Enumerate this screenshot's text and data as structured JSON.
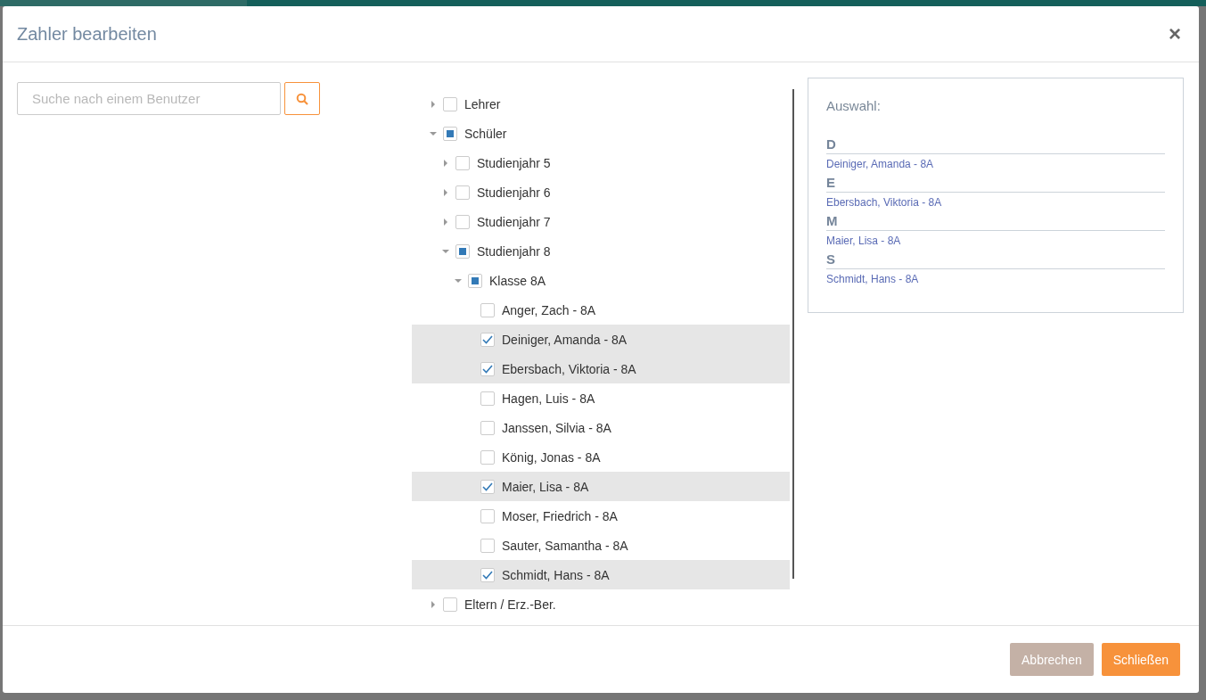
{
  "dialog": {
    "title": "Zahler bearbeiten",
    "close": "×"
  },
  "search": {
    "placeholder": "Suche nach einem Benutzer"
  },
  "tree": [
    {
      "label": "Lehrer",
      "checked": false,
      "indeterminate": false,
      "expanded": false
    },
    {
      "label": "Schüler",
      "checked": false,
      "indeterminate": true,
      "expanded": true,
      "children": [
        {
          "label": "Studienjahr 5",
          "checked": false,
          "indeterminate": false,
          "expanded": false
        },
        {
          "label": "Studienjahr 6",
          "checked": false,
          "indeterminate": false,
          "expanded": false
        },
        {
          "label": "Studienjahr 7",
          "checked": false,
          "indeterminate": false,
          "expanded": false
        },
        {
          "label": "Studienjahr 8",
          "checked": false,
          "indeterminate": true,
          "expanded": true,
          "children": [
            {
              "label": "Klasse 8A",
              "checked": false,
              "indeterminate": true,
              "expanded": true,
              "children": [
                {
                  "label": "Anger, Zach - 8A",
                  "checked": false
                },
                {
                  "label": "Deiniger, Amanda - 8A",
                  "checked": true
                },
                {
                  "label": "Ebersbach, Viktoria - 8A",
                  "checked": true
                },
                {
                  "label": "Hagen, Luis - 8A",
                  "checked": false
                },
                {
                  "label": "Janssen, Silvia - 8A",
                  "checked": false
                },
                {
                  "label": "König, Jonas - 8A",
                  "checked": false
                },
                {
                  "label": "Maier, Lisa - 8A",
                  "checked": true
                },
                {
                  "label": "Moser, Friedrich - 8A",
                  "checked": false
                },
                {
                  "label": "Sauter, Samantha - 8A",
                  "checked": false
                },
                {
                  "label": "Schmidt, Hans - 8A",
                  "checked": true
                }
              ]
            }
          ]
        }
      ]
    },
    {
      "label": "Eltern / Erz.-Ber.",
      "checked": false,
      "indeterminate": false,
      "expanded": false
    }
  ],
  "selection": {
    "label": "Auswahl:",
    "groups": [
      {
        "letter": "D",
        "items": [
          "Deiniger, Amanda - 8A"
        ]
      },
      {
        "letter": "E",
        "items": [
          "Ebersbach, Viktoria - 8A"
        ]
      },
      {
        "letter": "M",
        "items": [
          "Maier, Lisa - 8A"
        ]
      },
      {
        "letter": "S",
        "items": [
          "Schmidt, Hans - 8A"
        ]
      }
    ]
  },
  "buttons": [
    {
      "label": "Abbrechen",
      "kind": "cancel"
    },
    {
      "label": "Schließen",
      "kind": "primary"
    }
  ]
}
